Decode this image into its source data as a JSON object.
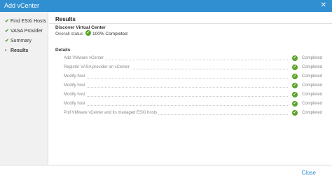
{
  "window": {
    "title": "Add vCenter",
    "close_glyph": "✕"
  },
  "sidebar": {
    "steps": [
      {
        "label": "Find ESXi Hosts",
        "state": "done"
      },
      {
        "label": "VASA Provider",
        "state": "done"
      },
      {
        "label": "Summary",
        "state": "done"
      },
      {
        "label": "Results",
        "state": "current"
      }
    ]
  },
  "content": {
    "heading": "Results",
    "discover": {
      "title": "Discover Virtual Center",
      "status_label": "Overall status",
      "status_value": "100% Completed"
    },
    "details": {
      "title": "Details",
      "rows": [
        {
          "label": "Add VMware vCenter",
          "result": "Completed"
        },
        {
          "label": "Register VASA provider on vCenter",
          "result": "Completed"
        },
        {
          "label": "Modify host",
          "result": "Completed"
        },
        {
          "label": "Modify host",
          "result": "Completed"
        },
        {
          "label": "Modify host",
          "result": "Completed"
        },
        {
          "label": "Modify host",
          "result": "Completed"
        },
        {
          "label": "Poll VMware vCenter and its managed ESXi hosts",
          "result": "Completed"
        }
      ]
    }
  },
  "footer": {
    "close_label": "Close"
  },
  "colors": {
    "titlebar": "#2f8fd1",
    "success": "#5aa32b",
    "link": "#2f8fd1"
  },
  "icons": {
    "step_done": "check-icon",
    "step_current": "bullet-icon",
    "status": "check-circle-icon"
  }
}
